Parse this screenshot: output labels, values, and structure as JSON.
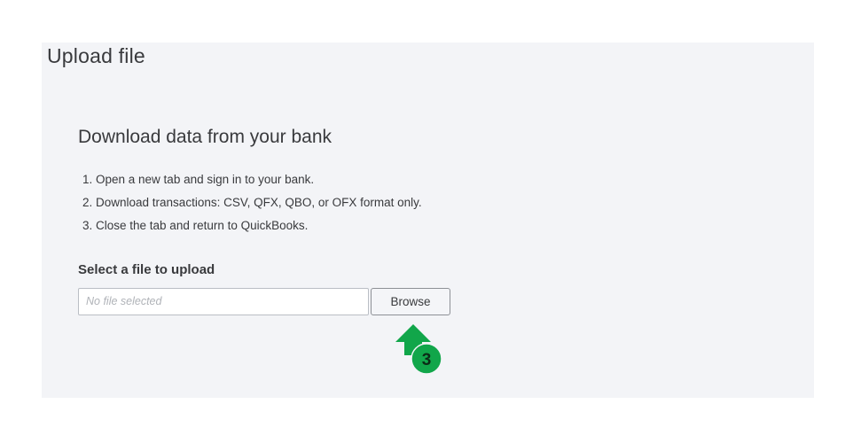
{
  "page": {
    "title": "Upload file"
  },
  "section": {
    "heading": "Download data from your bank",
    "steps": [
      "1. Open a new tab and sign in to your bank.",
      "2. Download transactions: CSV, QFX, QBO, or OFX format only.",
      "3. Close the tab and return to QuickBooks."
    ]
  },
  "upload": {
    "label": "Select a file to upload",
    "placeholder": "No file selected",
    "browse_label": "Browse"
  },
  "annotation": {
    "step_number": "3",
    "icon": "arrow-up-icon",
    "color": "#11a64a"
  }
}
